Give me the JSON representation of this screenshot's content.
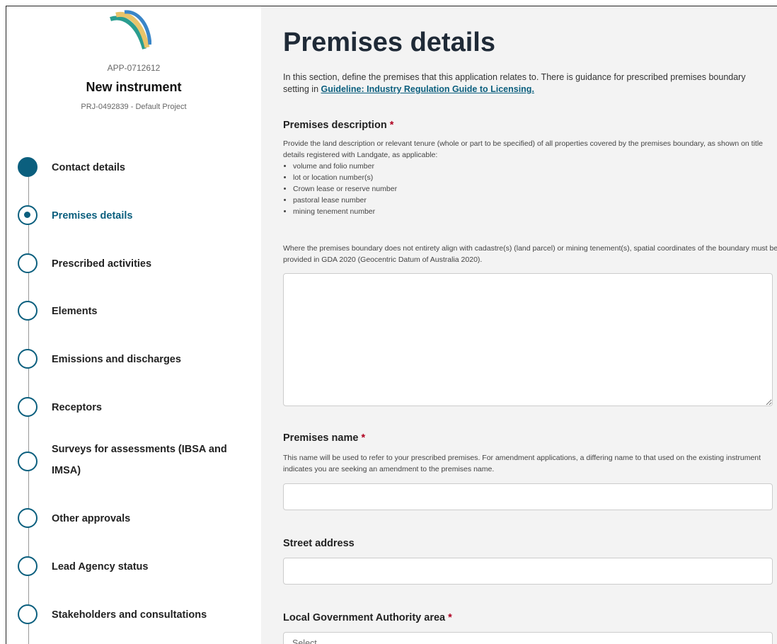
{
  "app": {
    "id": "APP-0712612",
    "title": "New instrument",
    "project": "PRJ-0492839 - Default Project",
    "brand_color": "#0b5f7e"
  },
  "steps": [
    {
      "label": "Contact details",
      "state": "done"
    },
    {
      "label": "Premises details",
      "state": "active"
    },
    {
      "label": "Prescribed activities",
      "state": "todo"
    },
    {
      "label": "Elements",
      "state": "todo"
    },
    {
      "label": "Emissions and discharges",
      "state": "todo"
    },
    {
      "label": "Receptors",
      "state": "todo"
    },
    {
      "label": "Surveys for assessments (IBSA and IMSA)",
      "state": "todo"
    },
    {
      "label": "Other approvals",
      "state": "todo"
    },
    {
      "label": "Lead Agency status",
      "state": "todo"
    },
    {
      "label": "Stakeholders and consultations",
      "state": "todo"
    }
  ],
  "page": {
    "title": "Premises details",
    "intro_text": "In this section, define the premises that this application relates to. There is guidance for prescribed premises boundary setting in ",
    "intro_link": "Guideline: Industry Regulation Guide to Licensing."
  },
  "premises_description": {
    "label": "Premises description",
    "required_mark": "*",
    "help_intro": "Provide the land description or relevant tenure (whole or part to be specified) of all properties covered by the premises boundary, as shown on title details registered with Landgate, as applicable:",
    "bullets": [
      "volume and folio number",
      "lot or location number(s)",
      "Crown lease or reserve number",
      "pastoral lease number",
      "mining tenement number"
    ],
    "help_outro": "Where the premises boundary does not entirety align with cadastre(s) (land parcel) or mining tenement(s), spatial coordinates of the boundary must be provided in GDA 2020 (Geocentric Datum of Australia 2020).",
    "value": ""
  },
  "premises_name": {
    "label": "Premises name",
    "required_mark": "*",
    "help": "This name will be used to refer to your prescribed premises. For amendment applications, a differing name to that used on the existing instrument indicates you are seeking an amendment to the premises name.",
    "value": ""
  },
  "street_address": {
    "label": "Street address",
    "value": ""
  },
  "lga": {
    "label": "Local Government Authority area",
    "required_mark": "*",
    "selected": "Select"
  }
}
